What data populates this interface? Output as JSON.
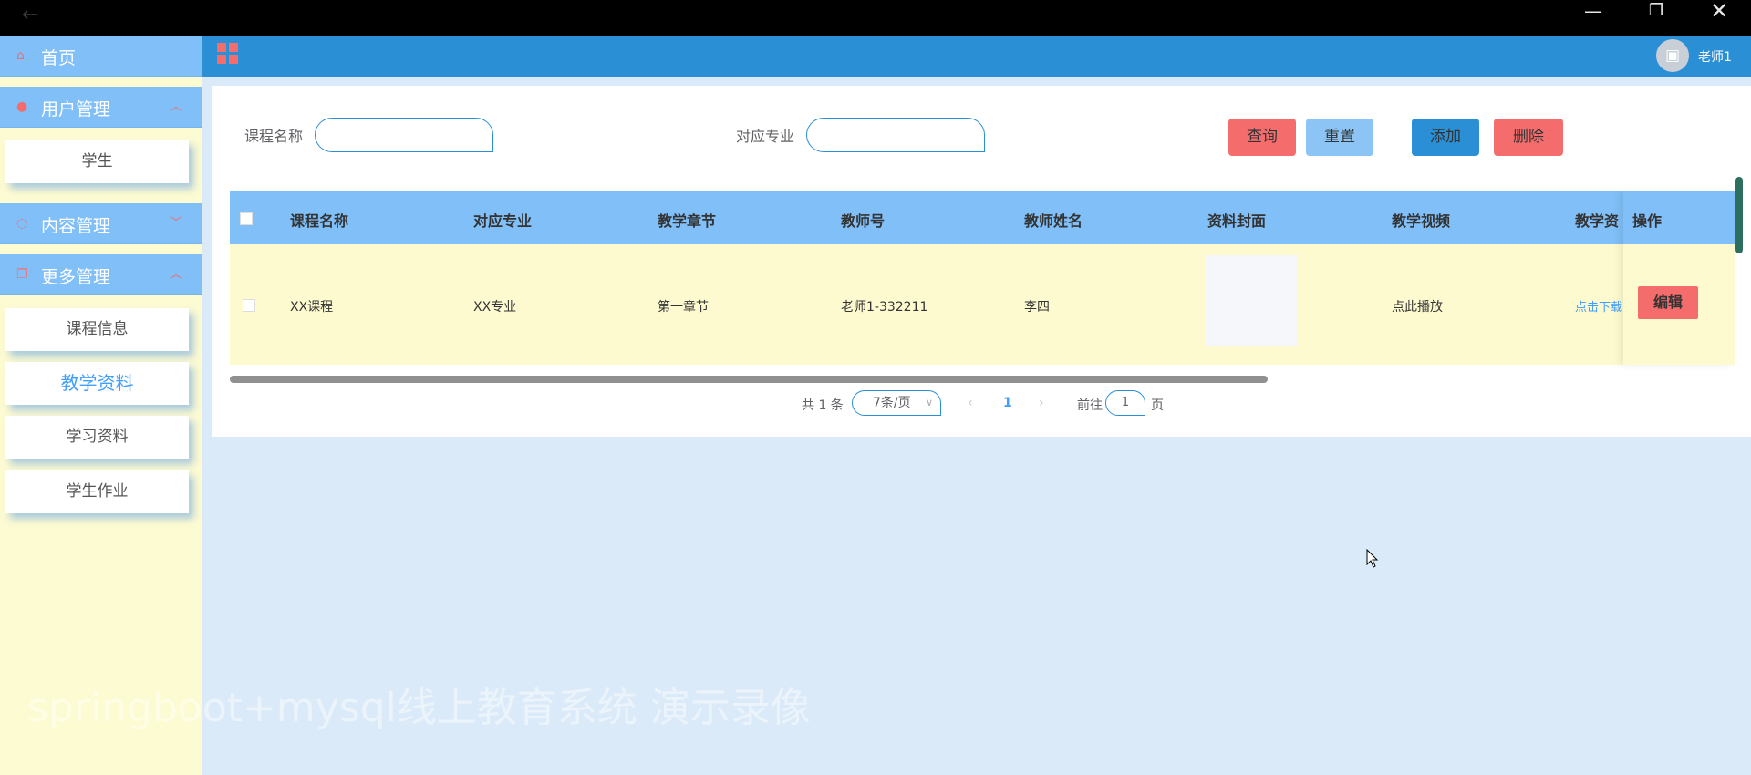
{
  "window": {
    "back_icon": "←",
    "minimize_icon": "—",
    "maximize_icon": "❐",
    "close_icon": "✕"
  },
  "sidebar": {
    "home": {
      "label": "首页",
      "icon": "home-icon"
    },
    "groups": [
      {
        "label": "用户管理",
        "icon": "user-icon",
        "expanded": true,
        "items": [
          "学生"
        ]
      },
      {
        "label": "内容管理",
        "icon": "chat-icon",
        "expanded": false,
        "items": []
      },
      {
        "label": "更多管理",
        "icon": "copy-icon",
        "expanded": true,
        "items": [
          "课程信息",
          "教学资料",
          "学习资料",
          "学生作业"
        ]
      }
    ],
    "active_item": "教学资料"
  },
  "header": {
    "user_name": "老师1",
    "menu_icon": "grid-icon",
    "avatar_icon": "image-icon"
  },
  "filters": {
    "course_label": "课程名称",
    "course_value": "",
    "major_label": "对应专业",
    "major_value": ""
  },
  "buttons": {
    "query": "查询",
    "reset": "重置",
    "add": "添加",
    "delete": "删除"
  },
  "table": {
    "columns": [
      "课程名称",
      "对应专业",
      "教学章节",
      "教师号",
      "教师姓名",
      "资料封面",
      "教学视频",
      "教学资"
    ],
    "op_header": "操作",
    "rows": [
      {
        "course": "XX课程",
        "major": "XX专业",
        "chapter": "第一章节",
        "teacher_no": "老师1-332211",
        "teacher_name": "李四",
        "video": "点此播放",
        "material": "点击下载",
        "edit": "编辑"
      }
    ]
  },
  "pagination": {
    "total": "共 1 条",
    "page_size": "7条/页",
    "current": "1",
    "goto_label": "前往",
    "goto_value": "1",
    "page_label": "页"
  },
  "colors": {
    "header_bar": "#2a8fd4",
    "sidebar_head": "#80bff8",
    "accent_red": "#f56c6c",
    "row_bg": "#fdfad0"
  },
  "watermark": "springboot+mysql线上教育系统 演示录像"
}
